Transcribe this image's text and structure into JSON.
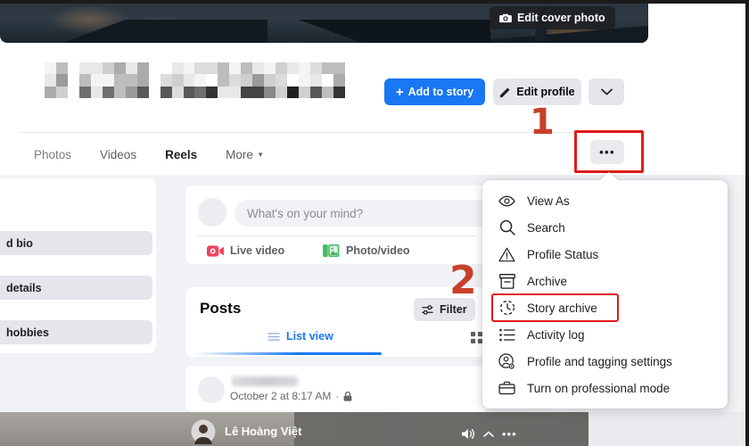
{
  "cover": {
    "edit_cover_label": "Edit cover photo",
    "edit_cover_icon": "camera-icon"
  },
  "profile": {
    "name_censored": true,
    "actions": {
      "add_to_story": "Add to story",
      "add_to_story_icon": "plus-icon",
      "edit_profile": "Edit profile",
      "edit_profile_icon": "pencil-icon",
      "caret_icon": "chevron-down-icon",
      "more_icon": "ellipsis-icon"
    }
  },
  "tabs": [
    {
      "label": "Photos",
      "state": "inactive"
    },
    {
      "label": "Videos",
      "state": "inactive"
    },
    {
      "label": "Reels",
      "state": "active"
    },
    {
      "label": "More",
      "state": "dim",
      "caret": "▾"
    }
  ],
  "left_cards": [
    {
      "label": "d bio"
    },
    {
      "label": "details"
    },
    {
      "label": "hobbies"
    }
  ],
  "composer": {
    "placeholder": "What's on your mind?",
    "actions": [
      {
        "label": "Live video",
        "icon": "live-video-icon"
      },
      {
        "label": "Photo/video",
        "icon": "photo-video-icon"
      }
    ]
  },
  "posts": {
    "title": "Posts",
    "filter_label": "Filter",
    "filter_icon": "sliders-icon",
    "list_view_label": "List view",
    "list_view_icon": "list-icon",
    "grid_view_icon": "grid-icon"
  },
  "post": {
    "timestamp": "October 2 at 8:17 AM",
    "separator": "·",
    "privacy_icon": "lock-icon"
  },
  "video_overlay": {
    "name": "Lê Hoàng Việt",
    "icons": [
      "volume-icon",
      "chevron-icon",
      "ellipsis-icon"
    ]
  },
  "menu": {
    "items": [
      {
        "label": "View As",
        "icon": "eye-icon"
      },
      {
        "label": "Search",
        "icon": "search-icon"
      },
      {
        "label": "Profile Status",
        "icon": "warning-triangle-icon"
      },
      {
        "label": "Archive",
        "icon": "archive-box-icon"
      },
      {
        "label": "Story archive",
        "icon": "clock-history-icon",
        "highlighted": true
      },
      {
        "label": "Activity log",
        "icon": "list-bullets-icon"
      },
      {
        "label": "Profile and tagging settings",
        "icon": "person-gear-icon"
      },
      {
        "label": "Turn on professional mode",
        "icon": "briefcase-icon"
      }
    ]
  },
  "annotations": [
    {
      "id": "marker-1",
      "label": "1",
      "color": "#c8402a"
    },
    {
      "id": "marker-2",
      "label": "2",
      "color": "#c8402a"
    }
  ],
  "colors": {
    "facebook_blue": "#1877f2",
    "highlight_red": "#e01b1b",
    "marker_orange": "#c8402a",
    "page_bg": "#f0f2f5",
    "button_grey": "#e4e6eb"
  }
}
